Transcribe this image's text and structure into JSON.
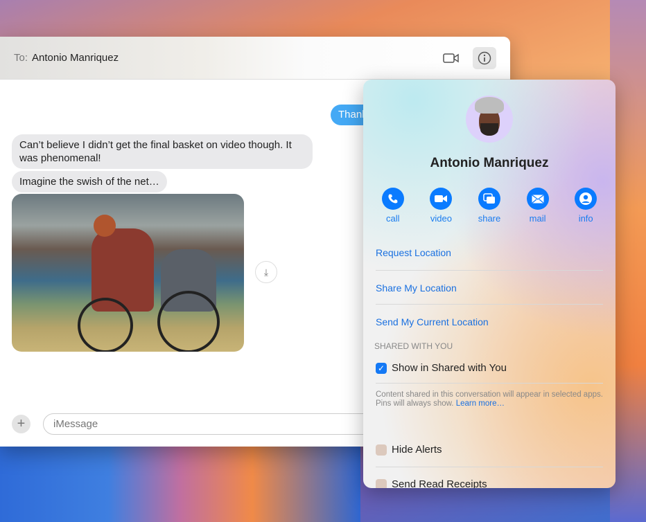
{
  "header": {
    "to_label": "To:",
    "recipient": "Antonio Manriquez"
  },
  "messages": {
    "sent_partial": "Thanks",
    "received": [
      "Can’t believe I didn’t get the final basket on video though. It was phenomenal!",
      "Imagine the swish of the net…"
    ]
  },
  "compose": {
    "placeholder": "iMessage"
  },
  "popover": {
    "name": "Antonio Manriquez",
    "actions": [
      {
        "label": "call",
        "icon": "phone-icon"
      },
      {
        "label": "video",
        "icon": "video-icon"
      },
      {
        "label": "share",
        "icon": "share-screen-icon"
      },
      {
        "label": "mail",
        "icon": "mail-icon"
      },
      {
        "label": "info",
        "icon": "person-icon"
      }
    ],
    "links": [
      "Request Location",
      "Share My Location",
      "Send My Current Location"
    ],
    "shared_header": "SHARED WITH YOU",
    "show_shared": {
      "label": "Show in Shared with You",
      "checked": true
    },
    "note": "Content shared in this conversation will appear in selected apps. Pins will always show.",
    "learn_more": "Learn more…",
    "hide_alerts": {
      "label": "Hide Alerts",
      "checked": false
    },
    "read_receipts": {
      "label": "Send Read Receipts",
      "checked": false
    }
  },
  "colors": {
    "accent": "#0a7bff",
    "sent_bubble": "#44a9f5"
  }
}
